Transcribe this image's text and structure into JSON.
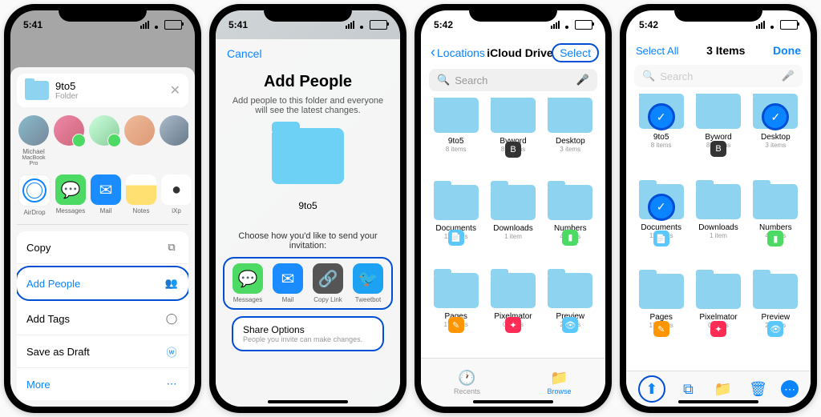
{
  "status": {
    "time1": "5:41",
    "time2": "5:42"
  },
  "screen1": {
    "folder_name": "9to5",
    "folder_sub": "Folder",
    "people": [
      {
        "name": "Michael",
        "sub": "MacBook Pro"
      },
      {
        "name": "",
        "sub": ""
      },
      {
        "name": "",
        "sub": ""
      },
      {
        "name": "",
        "sub": ""
      },
      {
        "name": "",
        "sub": ""
      }
    ],
    "apps": [
      "AirDrop",
      "Messages",
      "Mail",
      "Notes",
      "iXp"
    ],
    "actions": {
      "copy": "Copy",
      "add_people": "Add People",
      "add_tags": "Add Tags",
      "save_draft": "Save as Draft",
      "more": "More"
    }
  },
  "screen2": {
    "cancel": "Cancel",
    "title": "Add People",
    "subtitle": "Add people to this folder and everyone will see the latest changes.",
    "folder_name": "9to5",
    "choose": "Choose how you'd like to send your invitation:",
    "apps": [
      "Messages",
      "Mail",
      "Copy Link",
      "Tweetbot"
    ],
    "share_options": "Share Options",
    "share_sub": "People you invite can make changes."
  },
  "screen3": {
    "back": "Locations",
    "title": "iCloud Drive",
    "select": "Select",
    "search": "Search",
    "folders": [
      {
        "name": "9to5",
        "sub": "8 items",
        "badge": null
      },
      {
        "name": "Byword",
        "sub": "85 items",
        "badge": "B",
        "bcolor": "b-dark"
      },
      {
        "name": "Desktop",
        "sub": "3 items",
        "badge": null
      },
      {
        "name": "Documents",
        "sub": "11 items",
        "badge": "📄",
        "bcolor": "b-blue"
      },
      {
        "name": "Downloads",
        "sub": "1 item",
        "badge": null
      },
      {
        "name": "Numbers",
        "sub": "4 items",
        "badge": "▮",
        "bcolor": "b-green"
      },
      {
        "name": "Pages",
        "sub": "17 items",
        "badge": "✎",
        "bcolor": "b-orange"
      },
      {
        "name": "Pixelmator",
        "sub": "0 items",
        "badge": "✦",
        "bcolor": "b-pink"
      },
      {
        "name": "Preview",
        "sub": "2 items",
        "badge": "👁",
        "bcolor": "b-blue"
      }
    ],
    "tabs": {
      "recents": "Recents",
      "browse": "Browse"
    }
  },
  "screen4": {
    "select_all": "Select All",
    "title": "3 Items",
    "done": "Done",
    "search": "Search",
    "folders": [
      {
        "name": "9to5",
        "sub": "8 items",
        "badge": null,
        "selected": true
      },
      {
        "name": "Byword",
        "sub": "85 items",
        "badge": "B",
        "bcolor": "b-dark"
      },
      {
        "name": "Desktop",
        "sub": "3 items",
        "badge": null,
        "selected": true
      },
      {
        "name": "Documents",
        "sub": "11 items",
        "badge": "📄",
        "bcolor": "b-blue",
        "selected": true
      },
      {
        "name": "Downloads",
        "sub": "1 item",
        "badge": null
      },
      {
        "name": "Numbers",
        "sub": "4 items",
        "badge": "▮",
        "bcolor": "b-green"
      },
      {
        "name": "Pages",
        "sub": "17 items",
        "badge": "✎",
        "bcolor": "b-orange"
      },
      {
        "name": "Pixelmator",
        "sub": "0 items",
        "badge": "✦",
        "bcolor": "b-pink"
      },
      {
        "name": "Preview",
        "sub": "2 items",
        "badge": "👁",
        "bcolor": "b-blue"
      }
    ]
  }
}
